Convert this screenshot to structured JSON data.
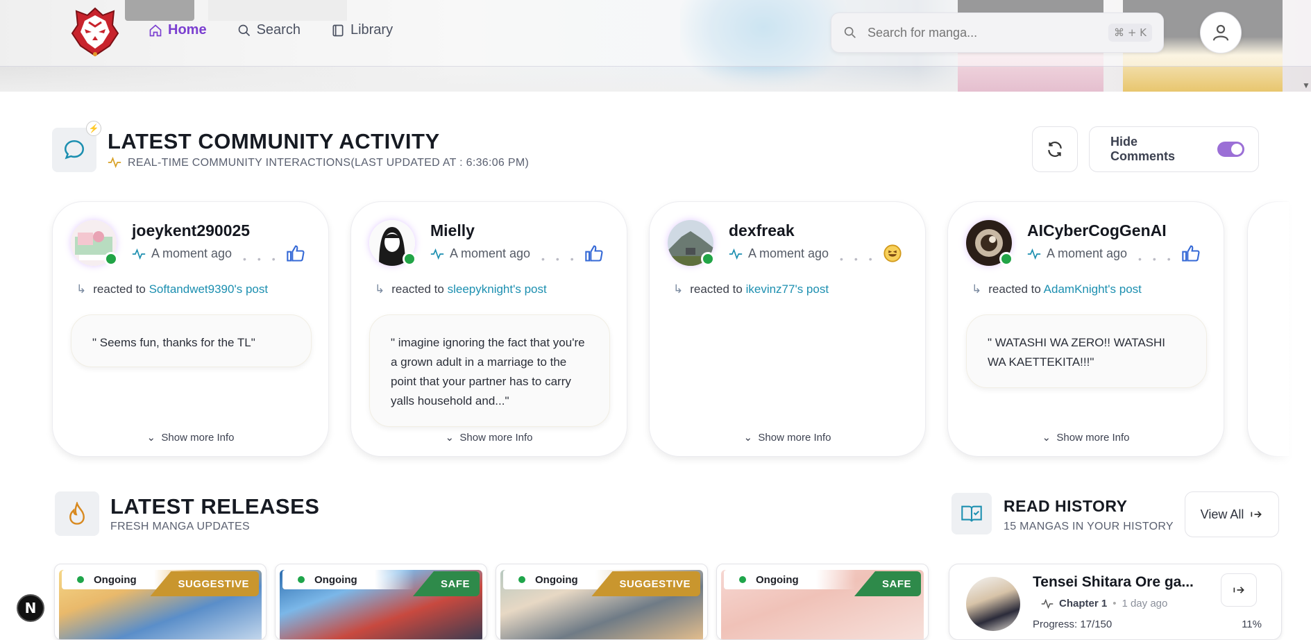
{
  "nav": {
    "home": "Home",
    "search": "Search",
    "library": "Library"
  },
  "search": {
    "placeholder": "Search for manga...",
    "shortcut": "⌘ + K"
  },
  "community": {
    "title": "LATEST COMMUNITY ACTIVITY",
    "subtitle": "REAL-TIME COMMUNITY INTERACTIONS(LAST UPDATED AT : 6:36:06 PM)",
    "hide_comments_label": "Hide Comments",
    "hide_comments_on": true,
    "cards": [
      {
        "user": "joeykent290025",
        "time": "A moment ago",
        "reaction": "thumbs-up-icon",
        "reacted_prefix": "reacted to",
        "target": "Softandwet9390's post",
        "comment": "\" Seems fun, thanks for the TL\"",
        "more": "Show more Info"
      },
      {
        "user": "Mielly",
        "time": "A moment ago",
        "reaction": "thumbs-up-icon",
        "reacted_prefix": "reacted to",
        "target": "sleepyknight's post",
        "comment": "\" imagine ignoring the fact that you're a grown adult in a marriage to the point that your partner has to carry yalls household and...\"",
        "more": "Show more Info"
      },
      {
        "user": "dexfreak",
        "time": "A moment ago",
        "reaction": "laugh-emoji-icon",
        "reacted_prefix": "reacted to",
        "target": "ikevinz77's post",
        "comment": "",
        "more": "Show more Info"
      },
      {
        "user": "AICyberCogGenAI",
        "time": "A moment ago",
        "reaction": "thumbs-up-icon",
        "reacted_prefix": "reacted to",
        "target": "AdamKnight's post",
        "comment": "\" WATASHI WA ZERO!! WATASHI WA KAETTEKITA!!!\"",
        "more": "Show more Info"
      }
    ]
  },
  "releases": {
    "title": "LATEST RELEASES",
    "subtitle": "FRESH MANGA UPDATES",
    "items": [
      {
        "status": "Ongoing",
        "rating": "SUGGESTIVE",
        "rating_color": "#c9962e"
      },
      {
        "status": "Ongoing",
        "rating": "SAFE",
        "rating_color": "#2e8a4a"
      },
      {
        "status": "Ongoing",
        "rating": "SUGGESTIVE",
        "rating_color": "#c9962e"
      },
      {
        "status": "Ongoing",
        "rating": "SAFE",
        "rating_color": "#2e8a4a"
      }
    ]
  },
  "history": {
    "title": "READ HISTORY",
    "subtitle": "15 MANGAS IN YOUR HISTORY",
    "view_all": "View All",
    "entry": {
      "title": "Tensei Shitara Ore ga...",
      "chapter": "Chapter 1",
      "time": "1 day ago",
      "progress_label": "Progress: 17/150",
      "progress_pct": "11%"
    }
  },
  "dev_badge": "N",
  "colors": {
    "accent": "#7b3fd0",
    "link": "#1c8fb0",
    "online": "#22a447"
  }
}
